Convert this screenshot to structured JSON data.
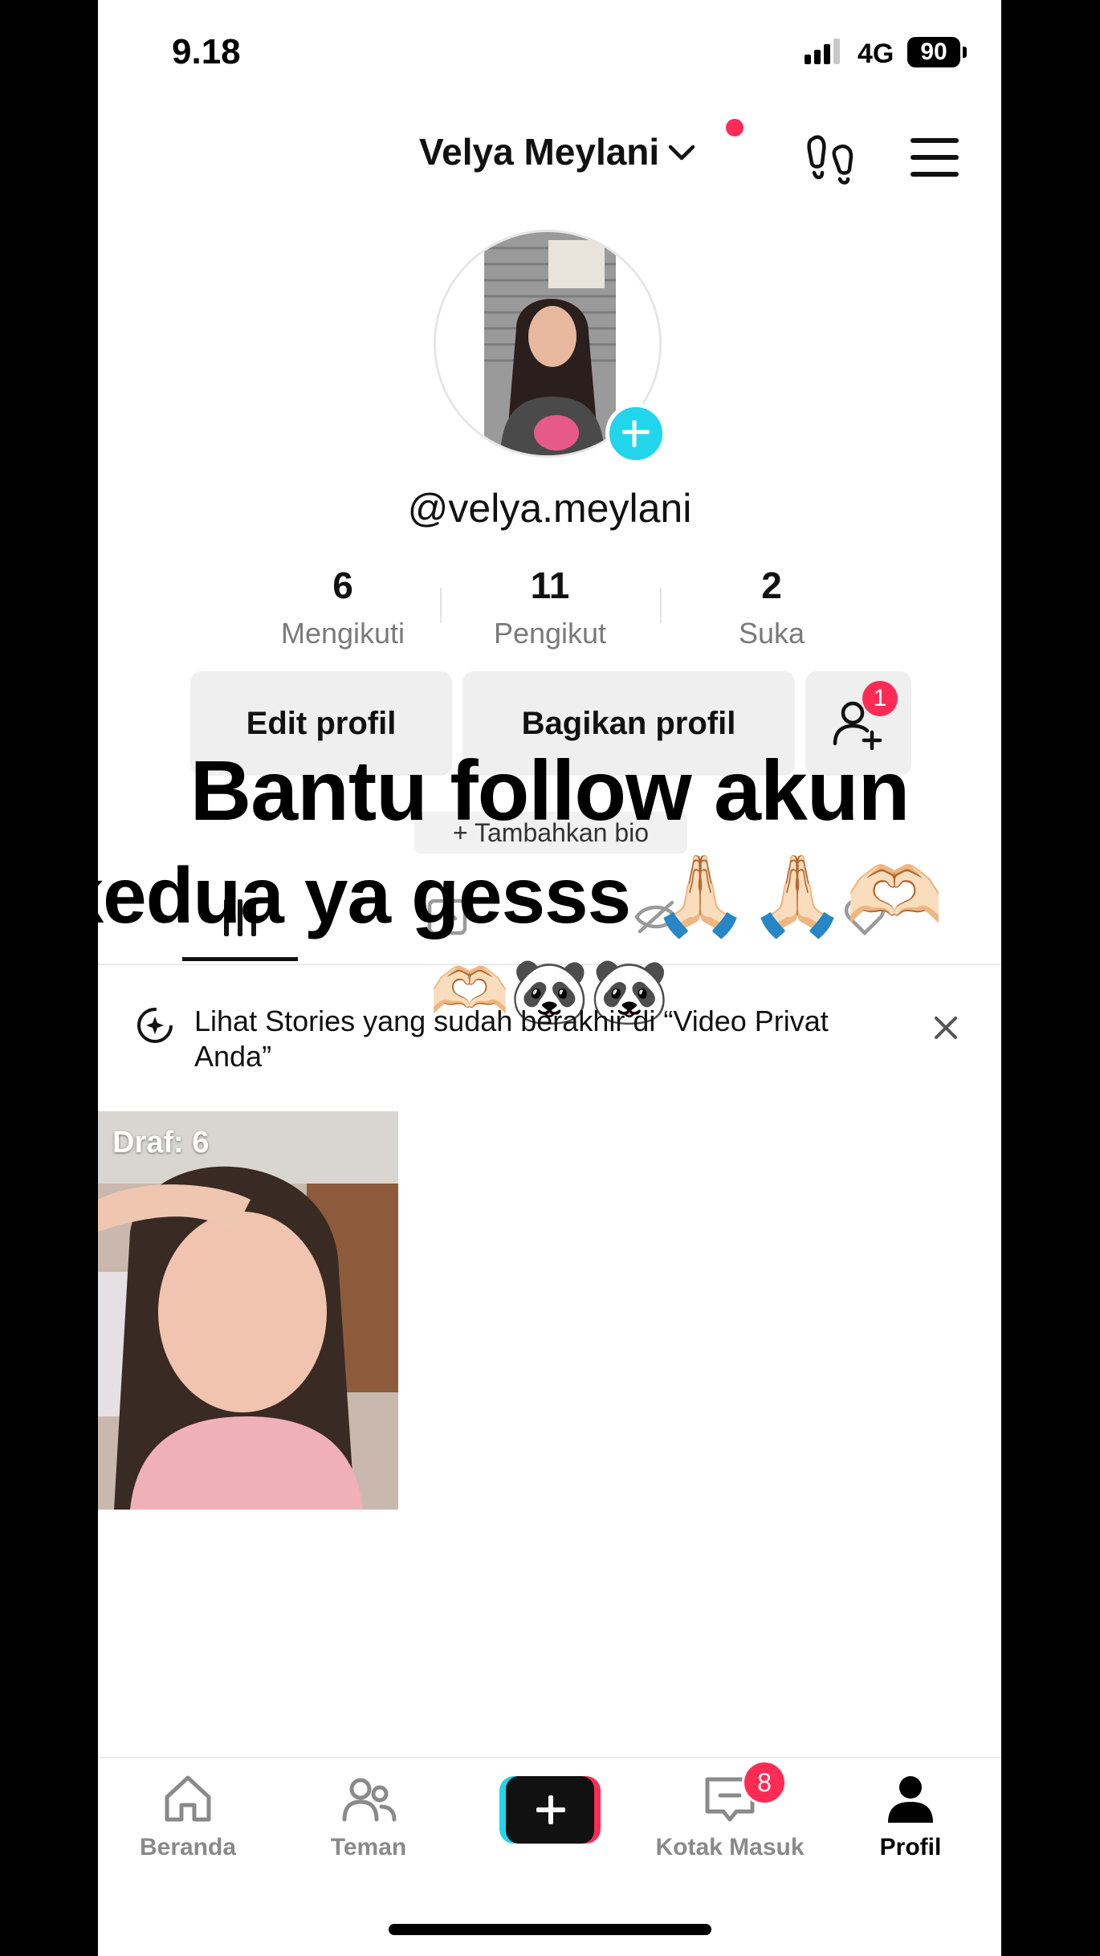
{
  "status_bar": {
    "time": "9.18",
    "network": "4G",
    "battery": "90"
  },
  "header": {
    "username": "Velya Meylani"
  },
  "profile": {
    "handle": "@velya.meylani",
    "stats": [
      {
        "value": "6",
        "label": "Mengikuti"
      },
      {
        "value": "11",
        "label": "Pengikut"
      },
      {
        "value": "2",
        "label": "Suka"
      }
    ],
    "edit_label": "Edit profil",
    "share_label": "Bagikan profil",
    "follow_badge": "1",
    "bio_add_label": "+ Tambahkan bio"
  },
  "overlay": {
    "line1": "Bantu follow akun",
    "line2": "kedua ya gesss 🙏🏻🙏🏻🫶🏻",
    "line3": "🫶🏻🐼🐼"
  },
  "stories_banner": {
    "text": "Lihat Stories yang sudah berakhir di “Video Privat Anda”"
  },
  "grid": {
    "draft_label": "Draf: 6"
  },
  "bottom_nav": {
    "items": [
      {
        "label": "Beranda",
        "icon": "home-icon"
      },
      {
        "label": "Teman",
        "icon": "friends-icon"
      },
      {
        "label": "",
        "icon": "create-icon"
      },
      {
        "label": "Kotak Masuk",
        "icon": "inbox-icon"
      },
      {
        "label": "Profil",
        "icon": "profile-icon"
      }
    ],
    "inbox_badge": "8"
  },
  "colors": {
    "accent_red": "#fe2c55",
    "accent_cyan": "#20d5ec"
  }
}
